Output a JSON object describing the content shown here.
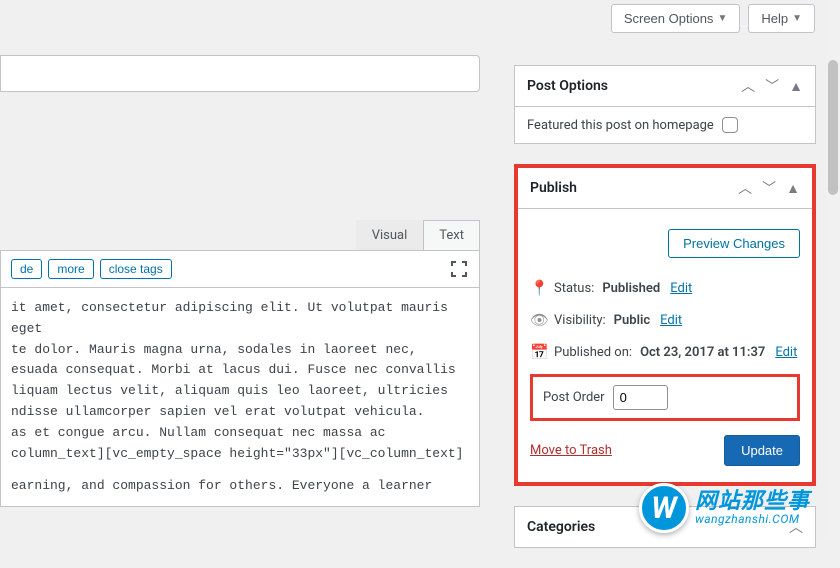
{
  "toolbar": {
    "screen_options": "Screen Options",
    "help": "Help"
  },
  "editor": {
    "tab_visual": "Visual",
    "tab_text": "Text",
    "tag_buttons": [
      "de",
      "more",
      "close tags"
    ],
    "content_lines": [
      "it amet, consectetur adipiscing elit. Ut volutpat mauris eget",
      "te dolor. Mauris magna urna, sodales in laoreet nec,",
      "esuada consequat. Morbi at lacus dui. Fusce nec convallis",
      "liquam lectus velit, aliquam quis leo laoreet, ultricies",
      "ndisse ullamcorper sapien vel erat volutpat vehicula.",
      "as et congue arcu. Nullam consequat nec massa ac",
      "column_text][vc_empty_space height=\"33px\"][vc_column_text]",
      "",
      "earning, and compassion for others. Everyone a learner"
    ]
  },
  "post_options": {
    "title": "Post Options",
    "featured_label": "Featured this post on homepage"
  },
  "publish": {
    "title": "Publish",
    "preview_label": "Preview Changes",
    "status_label": "Status:",
    "status_value": "Published",
    "visibility_label": "Visibility:",
    "visibility_value": "Public",
    "published_label": "Published on:",
    "published_value": "Oct 23, 2017 at 11:37",
    "edit_label": "Edit",
    "post_order_label": "Post Order",
    "post_order_value": "0",
    "trash_label": "Move to Trash",
    "update_label": "Update"
  },
  "categories": {
    "title": "Categories"
  },
  "watermark": {
    "cn": "网站那些事",
    "en": "wangzhanshi.COM"
  }
}
